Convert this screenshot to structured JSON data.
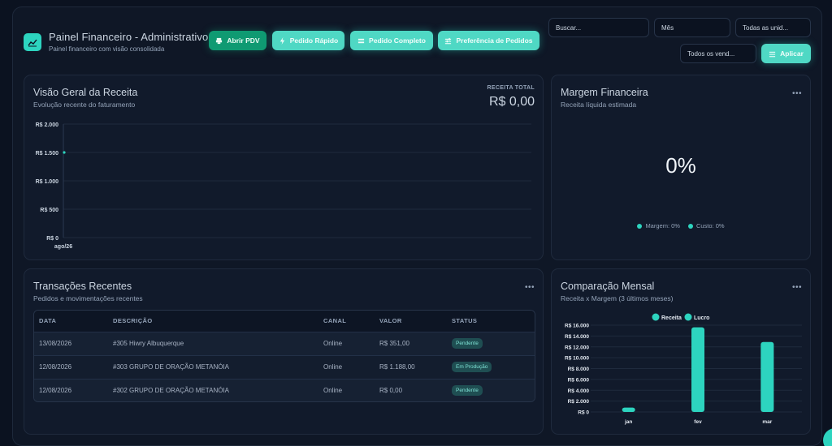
{
  "header": {
    "title": "Painel Financeiro - Administrativo",
    "subtitle": "Painel financeiro com visão consolidada"
  },
  "actions": {
    "open_pdv": "Abrir PDV",
    "quick_order": "Pedido Rápido",
    "full_order": "Pedido Completo",
    "order_prefs": "Preferência de Pedidos"
  },
  "filters": {
    "search_placeholder": "Buscar...",
    "month": "Mês",
    "units": "Todas as unid...",
    "sellers": "Todos os vend...",
    "apply": "Aplicar"
  },
  "revenue": {
    "title": "Visão Geral da Receita",
    "subtitle": "Evolução recente do faturamento",
    "kpi_label": "RECEITA TOTAL",
    "kpi_value": "R$ 0,00",
    "chart_data": {
      "type": "line",
      "x": [
        "ago/26"
      ],
      "series": [
        {
          "values": [
            1500
          ]
        }
      ],
      "ylim": [
        0,
        2000
      ],
      "yticks": [
        "R$ 0",
        "R$ 500",
        "R$ 1.000",
        "R$ 1.500",
        "R$ 2.000"
      ],
      "ytick_values": [
        0,
        500,
        1000,
        1500,
        2000
      ],
      "grid": true
    }
  },
  "margin": {
    "title": "Margem Financeira",
    "subtitle": "Receita líquida estimada",
    "value": "0%",
    "legend": [
      "Margem: 0%",
      "Custo: 0%"
    ],
    "colors": {
      "margin": "#2dd4bf",
      "cost": "#2dd4bf"
    }
  },
  "transactions": {
    "title": "Transações Recentes",
    "subtitle": "Pedidos e movimentações recentes",
    "columns": [
      "DATA",
      "DESCRIÇÃO",
      "CANAL",
      "VALOR",
      "STATUS"
    ],
    "rows": [
      [
        "13/08/2026",
        "#305 Hiwry Albuquerque",
        "Online",
        "R$ 351,00",
        "Pendente"
      ],
      [
        "12/08/2026",
        "#303 GRUPO DE ORAÇÃO METANÓIA",
        "Online",
        "R$ 1.188,00",
        "Em Produção"
      ],
      [
        "12/08/2026",
        "#302 GRUPO DE ORAÇÃO METANÓIA",
        "Online",
        "R$ 0,00",
        "Pendente"
      ]
    ]
  },
  "comparison": {
    "title": "Comparação Mensal",
    "subtitle": "Receita x Margem (3 últimos meses)",
    "chart_data": {
      "type": "bar",
      "categories": [
        "jan",
        "fev",
        "mar"
      ],
      "series": [
        {
          "name": "Receita",
          "values": [
            800,
            15600,
            12900
          ]
        },
        {
          "name": "Lucro",
          "values": [
            0,
            0,
            0
          ]
        }
      ],
      "ylim": [
        0,
        16000
      ],
      "yticks": [
        "R$ 0",
        "R$ 2.000",
        "R$ 4.000",
        "R$ 6.000",
        "R$ 8.000",
        "R$ 10.000",
        "R$ 12.000",
        "R$ 14.000",
        "R$ 16.000"
      ],
      "ytick_values": [
        0,
        2000,
        4000,
        6000,
        8000,
        10000,
        12000,
        14000,
        16000
      ],
      "legend_position": "top",
      "colors": {
        "Receita": "#2dd4bf",
        "Lucro": "#2dd4bf"
      }
    }
  }
}
